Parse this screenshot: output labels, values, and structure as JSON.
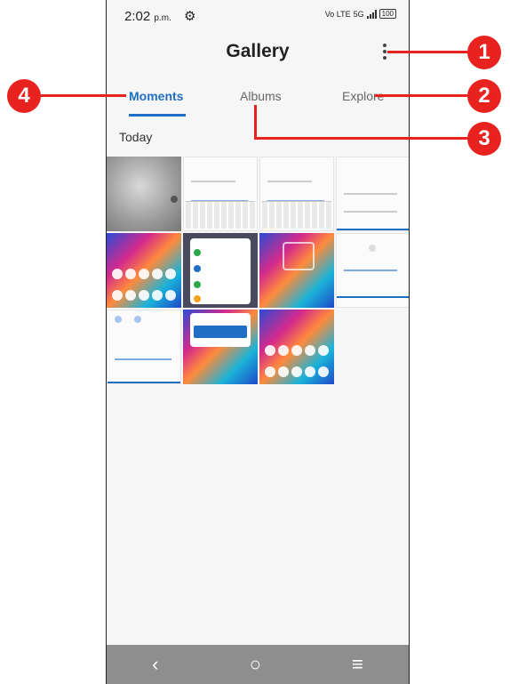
{
  "status_bar": {
    "time": "2:02",
    "time_suffix": "p.m.",
    "network": "Vo LTE",
    "network_5g": "5G",
    "battery": "100"
  },
  "header": {
    "title": "Gallery"
  },
  "tabs": [
    {
      "label": "Moments",
      "active": true
    },
    {
      "label": "Albums",
      "active": false
    },
    {
      "label": "Explore",
      "active": false
    }
  ],
  "section": {
    "title": "Today"
  },
  "thumbnails": [
    "photo",
    "screenshot-keyboard",
    "screenshot-keyboard",
    "screenshot-messages",
    "wallpaper-home",
    "screenshot-settings",
    "wallpaper-lock",
    "screenshot-quicksettings",
    "screenshot-quicksettings",
    "screenshot-notification",
    "wallpaper-home"
  ],
  "callouts": [
    "1",
    "2",
    "3",
    "4"
  ],
  "navbar": {
    "back_icon": "‹",
    "home_icon": "○",
    "recents_icon": "≡"
  },
  "colors": {
    "accent": "#1f6fc4",
    "callout": "#e8231f"
  }
}
